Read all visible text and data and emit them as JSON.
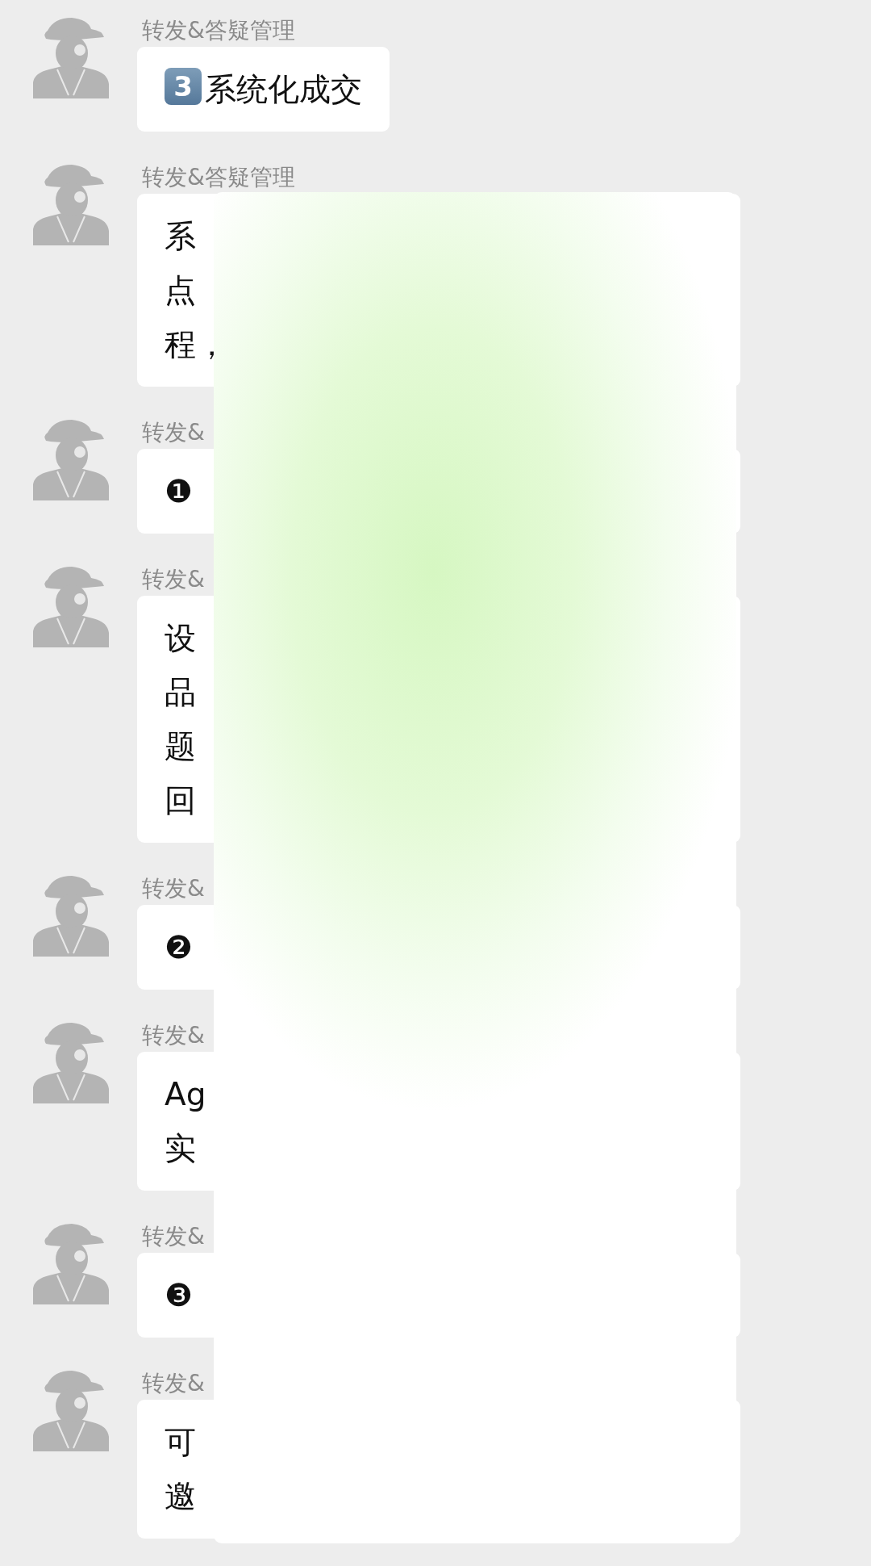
{
  "messages": [
    {
      "sender": "转发&答疑管理",
      "badge": "3",
      "lines": [
        "系统化成交"
      ]
    },
    {
      "sender": "转发&答疑管理",
      "lines": [
        "系",
        "点",
        "程，"
      ]
    },
    {
      "sender": "转发&",
      "lines": [
        "❶"
      ]
    },
    {
      "sender": "转发&",
      "lines": [
        "设",
        "品",
        "题",
        "回"
      ]
    },
    {
      "sender": "转发&",
      "lines": [
        "❷"
      ]
    },
    {
      "sender": "转发&",
      "lines": [
        "Ag",
        "实"
      ]
    },
    {
      "sender": "转发&",
      "lines": [
        "❸"
      ]
    },
    {
      "sender": "转发&",
      "lines": [
        "可",
        "邀"
      ]
    }
  ],
  "overlay": {
    "kind": "panel"
  }
}
